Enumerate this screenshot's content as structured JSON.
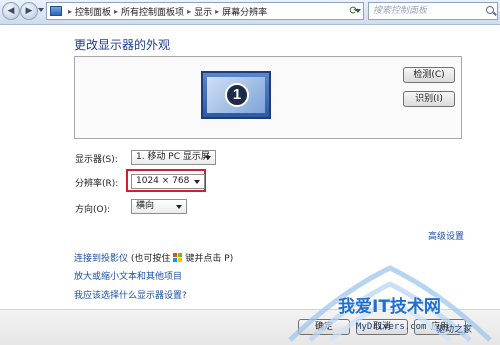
{
  "address_bar": {
    "breadcrumbs": [
      "控制面板",
      "所有控制面板项",
      "显示",
      "屏幕分辨率"
    ],
    "search_placeholder": "搜索控制面板",
    "back_icon": "back-arrow-icon",
    "forward_icon": "forward-arrow-icon",
    "refresh_icon": "refresh-icon"
  },
  "page": {
    "title": "更改显示器的外观"
  },
  "monitor_panel": {
    "monitor_number": "1",
    "detect_label": "检测(C)",
    "identify_label": "识别(I)"
  },
  "settings": {
    "display_label": "显示器(S):",
    "display_value": "1. 移动 PC 显示屏",
    "resolution_label": "分辨率(R):",
    "resolution_value": "1024 × 768",
    "orientation_label": "方向(O):",
    "orientation_value": "横向",
    "highlight_color": "#d31f2a"
  },
  "links": {
    "advanced": "高级设置",
    "project_link": "连接到投影仪",
    "project_hint_prefix": "(也可按住",
    "project_hint_suffix": "键并点击 P)",
    "text_size": "放大或缩小文本和其他项目",
    "which_settings": "我应该选择什么显示器设置?"
  },
  "footer": {
    "ok_label": "确定",
    "cancel_label": "取消",
    "apply_label": "应用"
  },
  "watermark": {
    "brand": "我爱IT技术网",
    "site": "MyDrivers.com",
    "home": "驱动之家"
  },
  "colors": {
    "link": "#1a4fa3",
    "title": "#1e3d8f"
  }
}
